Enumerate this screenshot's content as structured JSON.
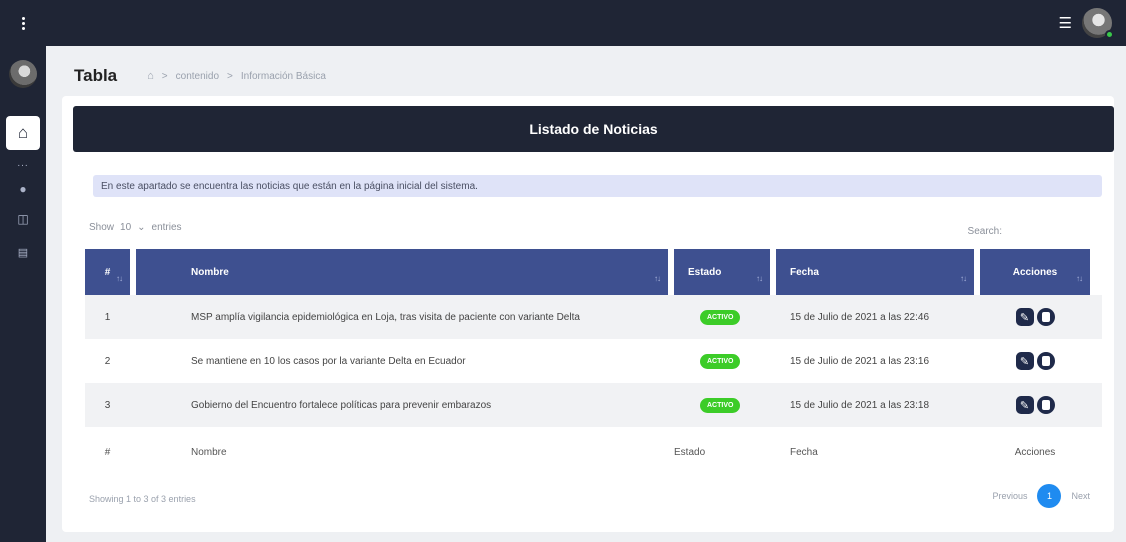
{
  "header": {
    "menu_icon": "list-icon",
    "avatar_icon": "user-avatar",
    "status_color": "#39c84a"
  },
  "sidebar": {
    "items": [
      "home-icon",
      "user-icon",
      "database-icon",
      "chart-icon"
    ]
  },
  "breadcrumb": {
    "title": "Tabla",
    "items": [
      "contenido",
      "Información Básica"
    ]
  },
  "card": {
    "title": "Listado de Noticias",
    "info": "En este apartado se encuentra las noticias que están en la página inicial del sistema."
  },
  "controls": {
    "show_label": "Show",
    "entries_value": "10",
    "entries_label": "entries",
    "search_label": "Search:",
    "search_value": ""
  },
  "table": {
    "columns": [
      "#",
      "Nombre",
      "Estado",
      "Fecha",
      "Acciones"
    ],
    "rows": [
      {
        "num": "1",
        "nombre": "MSP amplía vigilancia epidemiológica en Loja, tras visita de paciente con variante Delta",
        "estado": "ACTIVO",
        "fecha": "15 de Julio de 2021 a las 22:46"
      },
      {
        "num": "2",
        "nombre": "Se mantiene en 10 los casos por la variante Delta en Ecuador",
        "estado": "ACTIVO",
        "fecha": "15 de Julio de 2021 a las 23:16"
      },
      {
        "num": "3",
        "nombre": "Gobierno del Encuentro fortalece políticas para prevenir embarazos",
        "estado": "ACTIVO",
        "fecha": "15 de Julio de 2021 a las 23:18"
      }
    ]
  },
  "footer": {
    "showing": "Showing 1 to 3 of 3 entries",
    "previous": "Previous",
    "current_page": "1",
    "next": "Next"
  },
  "colors": {
    "dark": "#1f2535",
    "table_header": "#3e5090",
    "active": "#3ccc28",
    "page": "#1f8bf0"
  }
}
